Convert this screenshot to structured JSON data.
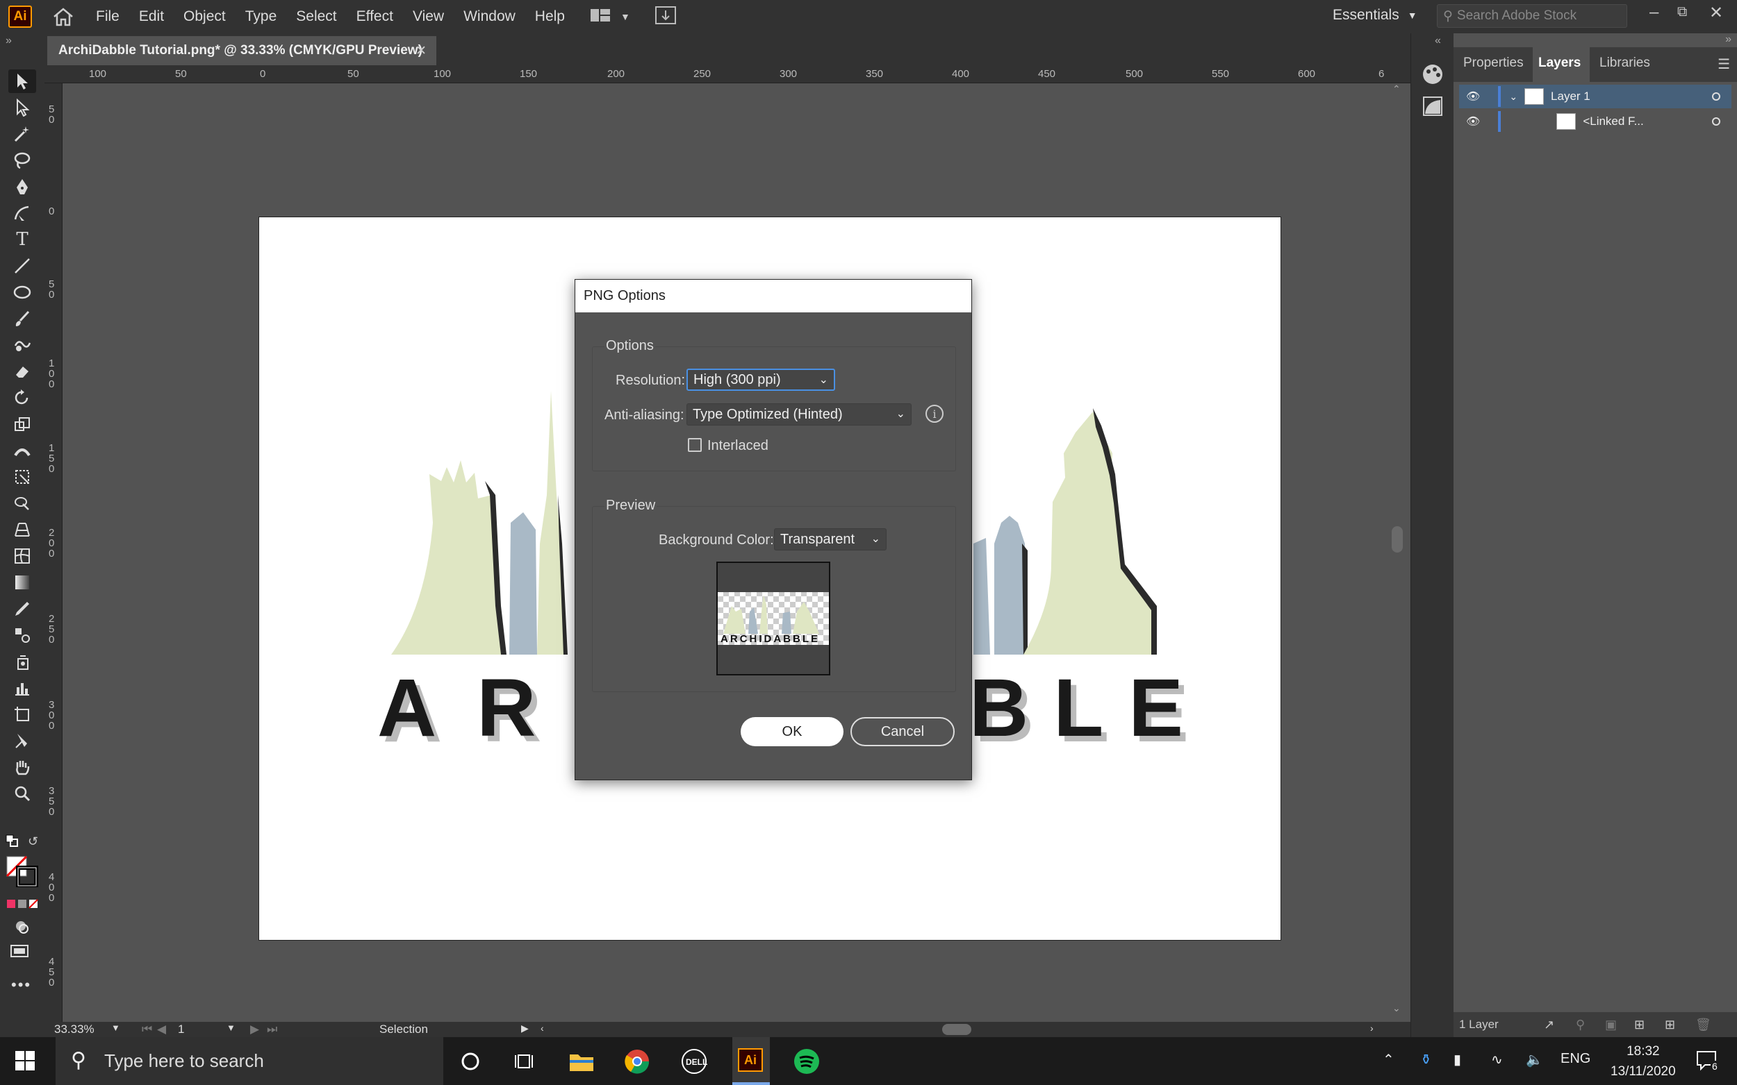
{
  "app": {
    "logo": "Ai",
    "menu": [
      "File",
      "Edit",
      "Object",
      "Type",
      "Select",
      "Effect",
      "View",
      "Window",
      "Help"
    ],
    "workspace": "Essentials",
    "stock_placeholder": "Search Adobe Stock",
    "doc_tab": "ArchiDabble Tutorial.png* @ 33.33% (CMYK/GPU Preview)"
  },
  "rulers": {
    "h_ticks": [
      "100",
      "50",
      "0",
      "50",
      "100",
      "150",
      "200",
      "250",
      "300",
      "350",
      "400",
      "450",
      "500",
      "550",
      "600",
      "6"
    ],
    "v_ticks": [
      "5\n0",
      "0",
      "5\n0",
      "1\n0\n0",
      "1\n5\n0",
      "2\n0\n0",
      "2\n5\n0",
      "3\n0\n0",
      "3\n5\n0",
      "4\n0\n0",
      "4\n5\n0"
    ]
  },
  "artwork": {
    "letters_left": "ARC",
    "letters_right": "BLE",
    "preview_text": "ARCHIDABBLE",
    "colors": {
      "green": "#dfe6c3",
      "blue": "#a9b9c6",
      "dark": "#1a1a1a"
    }
  },
  "dialog": {
    "title": "PNG Options",
    "options_label": "Options",
    "resolution_label": "Resolution:",
    "resolution_value": "High (300 ppi)",
    "antialias_label": "Anti-aliasing:",
    "antialias_value": "Type Optimized (Hinted)",
    "interlaced_label": "Interlaced",
    "interlaced_checked": false,
    "preview_label": "Preview",
    "bg_label": "Background Color:",
    "bg_value": "Transparent",
    "ok": "OK",
    "cancel": "Cancel"
  },
  "panel": {
    "tabs": [
      "Properties",
      "Layers",
      "Libraries"
    ],
    "active_tab": "Layers",
    "layers": [
      {
        "name": "Layer 1"
      },
      {
        "name": "<Linked F..."
      }
    ],
    "footer": "1 Layer"
  },
  "status": {
    "zoom": "33.33%",
    "artboard": "1",
    "tool": "Selection"
  },
  "taskbar": {
    "search_placeholder": "Type here to search",
    "lang": "ENG",
    "time": "18:32",
    "date": "13/11/2020",
    "notif_count": "6"
  }
}
